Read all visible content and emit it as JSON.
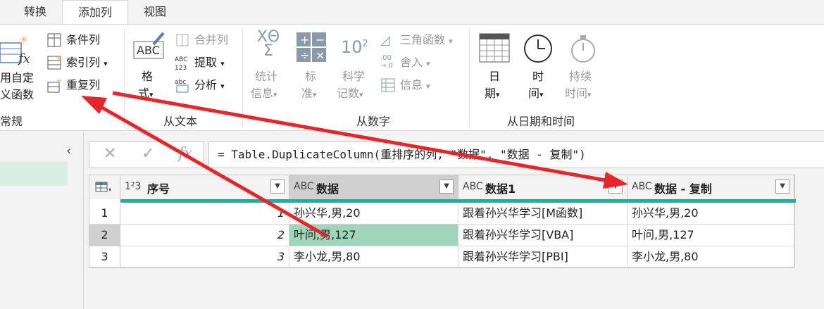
{
  "tabs": [
    {
      "label": "转换"
    },
    {
      "label": "添加列"
    },
    {
      "label": "视图"
    }
  ],
  "ribbon": {
    "general": {
      "custom_func_line1": "用自定",
      "custom_func_line2": "义函数",
      "conditional_column": "条件列",
      "index_column": "索引列",
      "duplicate_column": "重复列",
      "label": "常规"
    },
    "text": {
      "format_line1": "格",
      "format_line2": "式",
      "merge_columns": "合并列",
      "extract": "提取",
      "parse": "分析",
      "label": "从文本"
    },
    "number": {
      "statistics_line1": "统计",
      "statistics_line2": "信息",
      "standard_line1": "标",
      "standard_line2": "准",
      "scientific_line1": "科学",
      "scientific_line2": "记数",
      "trigonometry": "三角函数",
      "rounding": "舍入",
      "information": "信息",
      "label": "从数字"
    },
    "datetime": {
      "date_line1": "日",
      "date_line2": "期",
      "time_line1": "时",
      "time_line2": "间",
      "duration_line1": "持续",
      "duration_line2": "时间",
      "label": "从日期和时间"
    }
  },
  "formula": {
    "text": "= Table.DuplicateColumn(重排序的列, \"数据\", \"数据 - 复制\")"
  },
  "table": {
    "columns": [
      {
        "type": "1²3",
        "name": "序号"
      },
      {
        "type": "ABC",
        "name": "数据"
      },
      {
        "type": "ABC",
        "name": "数据1"
      },
      {
        "type": "ABC",
        "name": "数据 - 复制"
      }
    ],
    "rows": [
      {
        "num": "1",
        "index": "1",
        "data": "孙兴华,男,20",
        "data1": "跟着孙兴华学习[M函数]",
        "copy": "孙兴华,男,20"
      },
      {
        "num": "2",
        "index": "2",
        "data": "叶问,男,127",
        "data1": "跟着孙兴华学习[VBA]",
        "copy": "叶问,男,127"
      },
      {
        "num": "3",
        "index": "3",
        "data": "李小龙,男,80",
        "data1": "跟着孙兴华学习[PBI]",
        "copy": "李小龙,男,80"
      }
    ]
  },
  "colors": {
    "accent_teal": "#13b4a0",
    "selected_cell": "#9fd6bb",
    "arrow_red": "#e8262a"
  }
}
